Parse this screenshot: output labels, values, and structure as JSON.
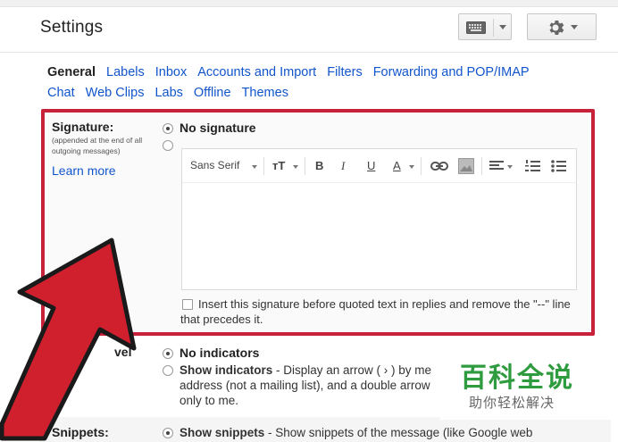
{
  "header": {
    "title": "Settings",
    "keyboard_icon": "keyboard-icon",
    "gear_icon": "gear-icon"
  },
  "tabs": {
    "row1": [
      {
        "label": "General",
        "active": true
      },
      {
        "label": "Labels",
        "active": false
      },
      {
        "label": "Inbox",
        "active": false
      },
      {
        "label": "Accounts and Import",
        "active": false
      },
      {
        "label": "Filters",
        "active": false
      },
      {
        "label": "Forwarding and POP/IMAP",
        "active": false
      }
    ],
    "row2": [
      {
        "label": "Chat",
        "active": false
      },
      {
        "label": "Web Clips",
        "active": false
      },
      {
        "label": "Labs",
        "active": false
      },
      {
        "label": "Offline",
        "active": false
      },
      {
        "label": "Themes",
        "active": false
      }
    ]
  },
  "signature": {
    "label": "Signature:",
    "sub": "(appended at the end of all outgoing messages)",
    "learn_more": "Learn more",
    "no_signature": "No signature",
    "toolbar": {
      "font": "Sans Serif",
      "size": "тT",
      "bold": "B",
      "italic": "I",
      "underline": "U",
      "text_color": "A"
    },
    "insert_text": "Insert this signature before quoted text in replies and remove the \"--\" line that precedes it."
  },
  "indicators": {
    "label_fragment": "vel",
    "no_indicators": "No indicators",
    "show_indicators": "Show indicators",
    "show_indicators_desc": " - Display an arrow ( › ) by me",
    "line2": "address (not a mailing list), and a double arrow",
    "line3": "only to me."
  },
  "snippets": {
    "label": "Snippets:",
    "show_snippets": "Show snippets",
    "desc": " - Show snippets of the message (like Google web"
  },
  "watermark": {
    "big": "百科全说",
    "small": "助你轻松解决"
  },
  "colors": {
    "link": "#1155cc",
    "highlight_border": "#c7223a",
    "arrow_fill": "#d0202e",
    "watermark_green": "#2e9b3e"
  }
}
